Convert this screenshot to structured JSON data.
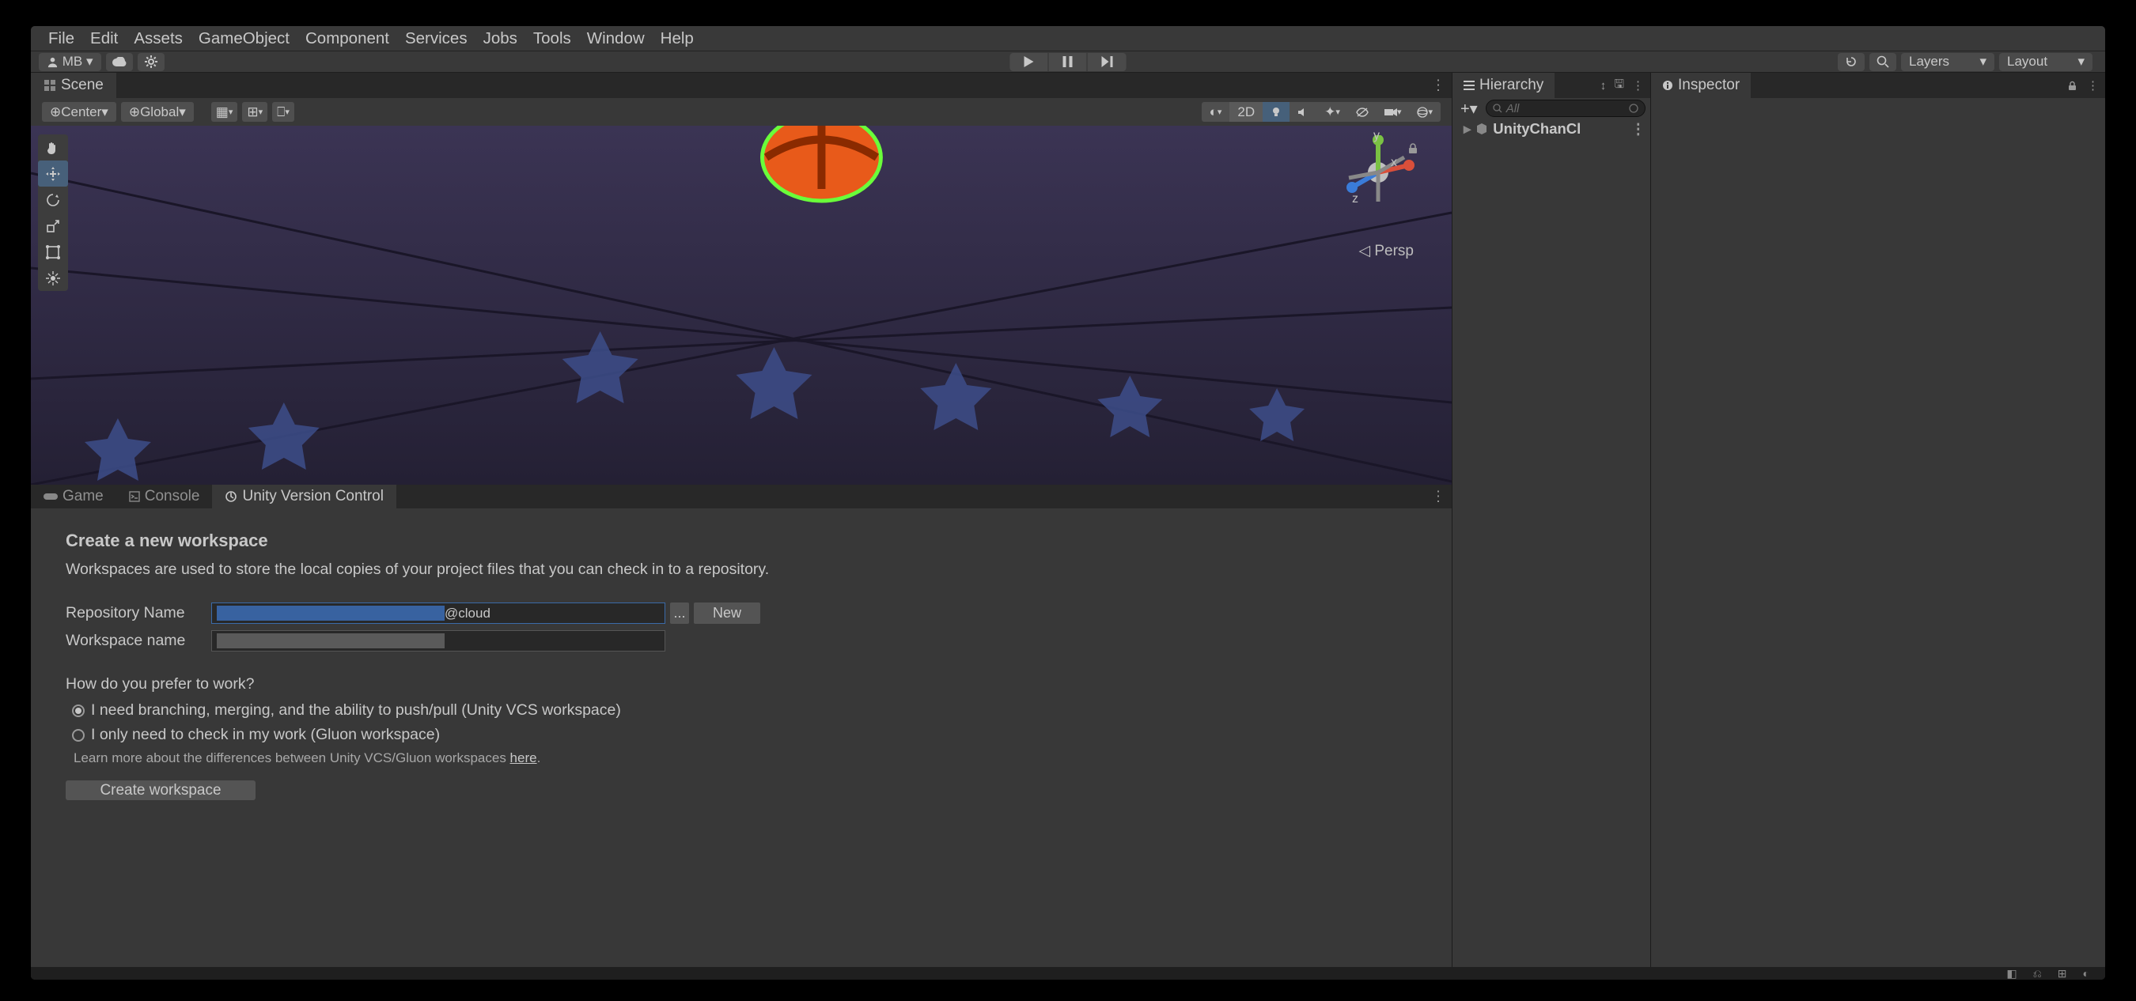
{
  "menu": {
    "items": [
      "File",
      "Edit",
      "Assets",
      "GameObject",
      "Component",
      "Services",
      "Jobs",
      "Tools",
      "Window",
      "Help"
    ]
  },
  "toolbar": {
    "account_label": "MB",
    "layers_label": "Layers",
    "layout_label": "Layout"
  },
  "scene": {
    "tab_label": "Scene",
    "pivot_label": "Center",
    "handle_label": "Global",
    "btn_2d": "2D",
    "persp_label": "Persp",
    "gizmo_x": "x",
    "gizmo_y": "y",
    "gizmo_z": "z"
  },
  "bottom_tabs": {
    "game": "Game",
    "console": "Console",
    "uvc": "Unity Version Control"
  },
  "workspace": {
    "heading": "Create a new workspace",
    "desc": "Workspaces are used to store the local copies of your project files that you can check in to a repository.",
    "repo_label": "Repository Name",
    "repo_value": "@cloud",
    "ws_label": "Workspace name",
    "ws_value": "",
    "browse_btn": "...",
    "new_btn": "New",
    "prefer_q": "How do you prefer to work?",
    "opt1": "I need branching, merging, and the ability to push/pull (Unity VCS workspace)",
    "opt2": "I only need to check in my work (Gluon workspace)",
    "note_pre": "Learn more about the differences between Unity VCS/Gluon workspaces ",
    "note_link": "here",
    "note_post": ".",
    "create_btn": "Create workspace"
  },
  "hierarchy": {
    "tab_label": "Hierarchy",
    "search_placeholder": "All",
    "root_item": "UnityChanCl"
  },
  "inspector": {
    "tab_label": "Inspector"
  }
}
